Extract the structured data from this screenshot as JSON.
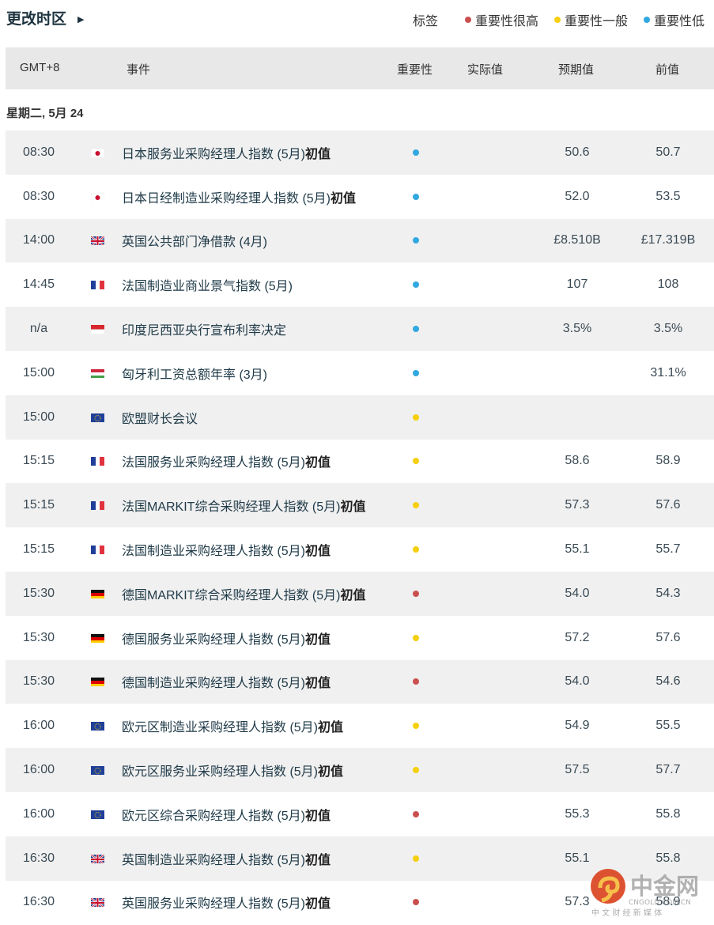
{
  "header": {
    "timezone_label": "更改时区",
    "legend_label": "标签",
    "legend": [
      {
        "label": "重要性很高",
        "color": "#c9504f"
      },
      {
        "label": "重要性一般",
        "color": "#f5cf10"
      },
      {
        "label": "重要性低",
        "color": "#31a8e0"
      }
    ]
  },
  "columns": {
    "time": "GMT+8",
    "event": "事件",
    "importance": "重要性",
    "actual": "实际值",
    "forecast": "预期值",
    "previous": "前值"
  },
  "date": "星期二, 5月 24",
  "importance_colors": {
    "high": "#c9504f",
    "medium": "#f5cf10",
    "low": "#31a8e0"
  },
  "rows": [
    {
      "time": "08:30",
      "flag": "jp",
      "event": "日本服务业采购经理人指数 (5月)",
      "suffix": "初值",
      "importance": "low",
      "actual": "",
      "forecast": "50.6",
      "previous": "50.7"
    },
    {
      "time": "08:30",
      "flag": "jp",
      "event": "日本日经制造业采购经理人指数 (5月)",
      "suffix": "初值",
      "importance": "low",
      "actual": "",
      "forecast": "52.0",
      "previous": "53.5"
    },
    {
      "time": "14:00",
      "flag": "gb",
      "event": "英国公共部门净借款 (4月)",
      "suffix": "",
      "importance": "low",
      "actual": "",
      "forecast": "£8.510B",
      "previous": "£17.319B"
    },
    {
      "time": "14:45",
      "flag": "fr",
      "event": "法国制造业商业景气指数 (5月)",
      "suffix": "",
      "importance": "low",
      "actual": "",
      "forecast": "107",
      "previous": "108"
    },
    {
      "time": "n/a",
      "flag": "id",
      "event": "印度尼西亚央行宣布利率决定",
      "suffix": "",
      "importance": "low",
      "actual": "",
      "forecast": "3.5%",
      "previous": "3.5%"
    },
    {
      "time": "15:00",
      "flag": "hu",
      "event": "匈牙利工资总额年率 (3月)",
      "suffix": "",
      "importance": "low",
      "actual": "",
      "forecast": "",
      "previous": "31.1%"
    },
    {
      "time": "15:00",
      "flag": "eu",
      "event": "欧盟财长会议",
      "suffix": "",
      "importance": "medium",
      "actual": "",
      "forecast": "",
      "previous": ""
    },
    {
      "time": "15:15",
      "flag": "fr",
      "event": "法国服务业采购经理人指数 (5月)",
      "suffix": "初值",
      "importance": "medium",
      "actual": "",
      "forecast": "58.6",
      "previous": "58.9"
    },
    {
      "time": "15:15",
      "flag": "fr",
      "event": "法国MARKIT综合采购经理人指数 (5月)",
      "suffix": "初值",
      "importance": "medium",
      "actual": "",
      "forecast": "57.3",
      "previous": "57.6"
    },
    {
      "time": "15:15",
      "flag": "fr",
      "event": "法国制造业采购经理人指数 (5月)",
      "suffix": "初值",
      "importance": "medium",
      "actual": "",
      "forecast": "55.1",
      "previous": "55.7"
    },
    {
      "time": "15:30",
      "flag": "de",
      "event": "德国MARKIT综合采购经理人指数 (5月)",
      "suffix": "初值",
      "importance": "high",
      "actual": "",
      "forecast": "54.0",
      "previous": "54.3"
    },
    {
      "time": "15:30",
      "flag": "de",
      "event": "德国服务业采购经理人指数 (5月)",
      "suffix": "初值",
      "importance": "medium",
      "actual": "",
      "forecast": "57.2",
      "previous": "57.6"
    },
    {
      "time": "15:30",
      "flag": "de",
      "event": "德国制造业采购经理人指数 (5月)",
      "suffix": "初值",
      "importance": "high",
      "actual": "",
      "forecast": "54.0",
      "previous": "54.6"
    },
    {
      "time": "16:00",
      "flag": "eu",
      "event": "欧元区制造业采购经理人指数 (5月)",
      "suffix": "初值",
      "importance": "medium",
      "actual": "",
      "forecast": "54.9",
      "previous": "55.5"
    },
    {
      "time": "16:00",
      "flag": "eu",
      "event": "欧元区服务业采购经理人指数 (5月)",
      "suffix": "初值",
      "importance": "medium",
      "actual": "",
      "forecast": "57.5",
      "previous": "57.7"
    },
    {
      "time": "16:00",
      "flag": "eu",
      "event": "欧元区综合采购经理人指数 (5月)",
      "suffix": "初值",
      "importance": "high",
      "actual": "",
      "forecast": "55.3",
      "previous": "55.8"
    },
    {
      "time": "16:30",
      "flag": "gb",
      "event": "英国制造业采购经理人指数 (5月)",
      "suffix": "初值",
      "importance": "medium",
      "actual": "",
      "forecast": "55.1",
      "previous": "55.8"
    },
    {
      "time": "16:30",
      "flag": "gb",
      "event": "英国服务业采购经理人指数 (5月)",
      "suffix": "初值",
      "importance": "high",
      "actual": "",
      "forecast": "57.3",
      "previous": "58.9"
    }
  ],
  "watermark": {
    "name": "中金网",
    "site": "CNGOLD.COM.CN",
    "tagline": "中 文 财 经 新 媒 体"
  }
}
